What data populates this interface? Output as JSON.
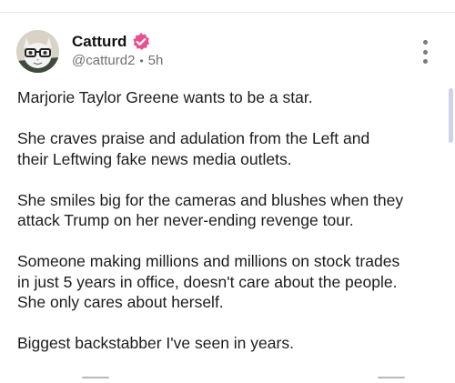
{
  "post": {
    "author": {
      "name": "Catturd",
      "handle": "@catturd2",
      "time": "5h",
      "verified": true,
      "badge_color": "#e8508f"
    },
    "separator": "•",
    "paragraphs": [
      "Marjorie Taylor Greene wants to be a star.",
      "She craves praise and adulation from the Left and\ntheir Leftwing fake news media outlets.",
      "She smiles big for the cameras and blushes when they\nattack Trump on her never-ending revenge tour.",
      "Someone making millions and millions on stock trades\nin just 5 years in office, doesn't care about the people.\nShe only cares about herself.",
      "Biggest backstabber I've seen in years."
    ]
  },
  "colors": {
    "text": "#1c1c1c",
    "muted": "#707070",
    "badge": "#e8508f",
    "scrollbar": "#cfd3ea"
  },
  "icons": {
    "avatar": "cat-with-glasses-avatar",
    "verified": "verified-badge-icon",
    "more": "more-vertical-icon"
  }
}
